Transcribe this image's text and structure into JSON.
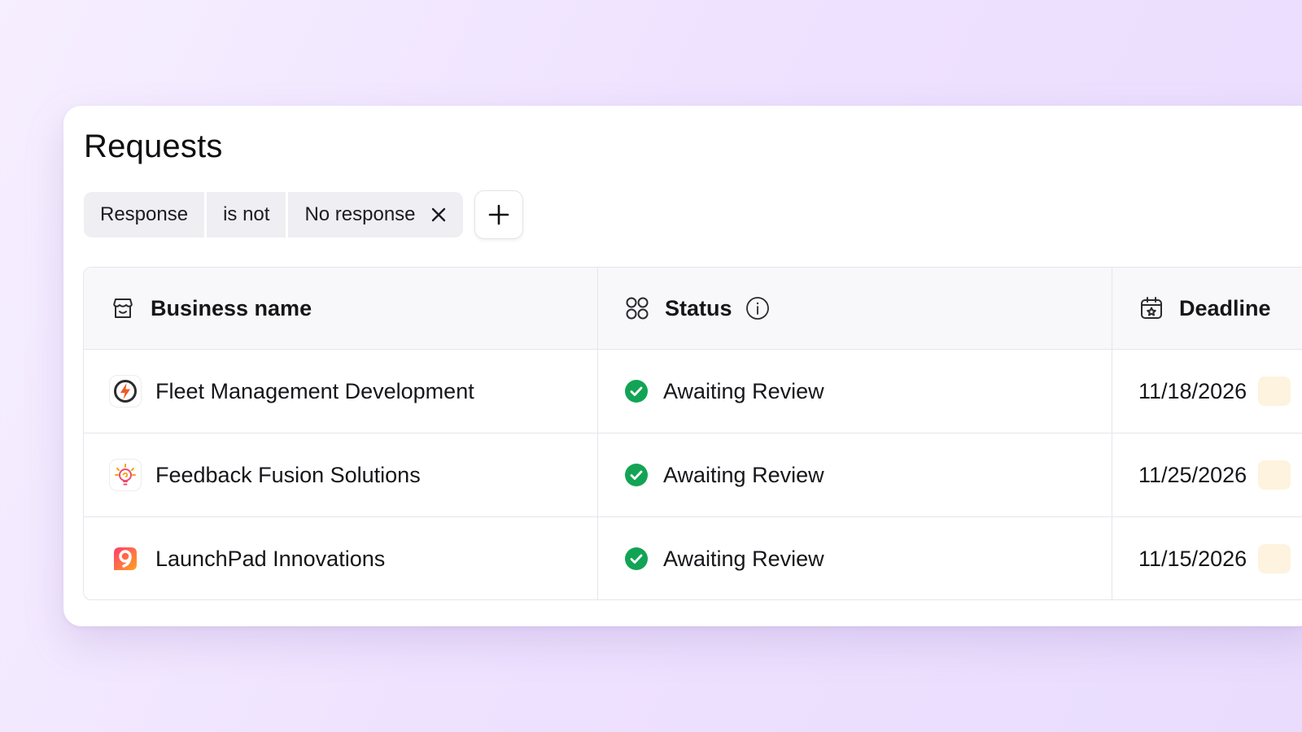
{
  "page": {
    "title": "Requests"
  },
  "filter": {
    "field": "Response",
    "operator": "is not",
    "value": "No response"
  },
  "table": {
    "columns": [
      {
        "label": "Business name",
        "icon": "storefront-icon"
      },
      {
        "label": "Status",
        "icon": "grid-circles-icon"
      },
      {
        "label": "Deadline",
        "icon": "calendar-star-icon"
      }
    ],
    "rows": [
      {
        "business": "Fleet Management Development",
        "logo": "lightning-bolt-logo",
        "status": "Awaiting Review",
        "deadline": "11/18/2026"
      },
      {
        "business": "Feedback Fusion Solutions",
        "logo": "lightbulb-logo",
        "status": "Awaiting Review",
        "deadline": "11/25/2026"
      },
      {
        "business": "LaunchPad Innovations",
        "logo": "number-nine-logo",
        "status": "Awaiting Review",
        "deadline": "11/15/2026"
      }
    ]
  },
  "colors": {
    "status_success": "#12a454",
    "chip_bg": "#efeef3",
    "deadline_badge": "#fdf3de"
  }
}
